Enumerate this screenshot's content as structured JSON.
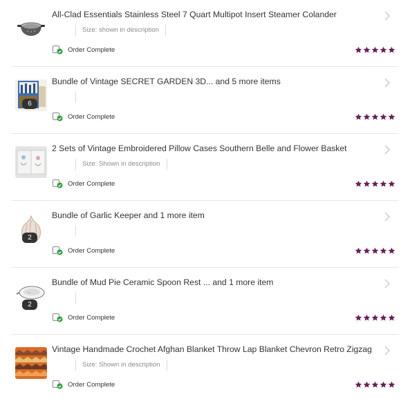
{
  "colors": {
    "star": "#6b1f55",
    "status_check": "#2e9e3e",
    "chevron": "#c8c8c8"
  },
  "orders": [
    {
      "title": "All-Clad Essentials Stainless Steel 7 Quart Multipot Insert Steamer Colander",
      "size": "Size: shown in description",
      "status": "Order Complete",
      "rating": 5,
      "count_badge": "",
      "thumb_icon": "steamer-colander-photo"
    },
    {
      "title": "Bundle of Vintage SECRET GARDEN 3D... and 5 more items",
      "size": "",
      "status": "Order Complete",
      "rating": 5,
      "count_badge": "6",
      "thumb_icon": "secret-garden-book-photo"
    },
    {
      "title": "2 Sets of Vintage Embroidered Pillow Cases Southern Belle and Flower Basket",
      "size": "Size: Shown in description",
      "status": "Order Complete",
      "rating": 5,
      "count_badge": "",
      "thumb_icon": "pillow-cases-photo"
    },
    {
      "title": "Bundle of Garlic Keeper and 1 more item",
      "size": "",
      "status": "Order Complete",
      "rating": 5,
      "count_badge": "2",
      "thumb_icon": "garlic-keeper-photo"
    },
    {
      "title": "Bundle of Mud Pie Ceramic Spoon Rest ... and 1 more item",
      "size": "",
      "status": "Order Complete",
      "rating": 5,
      "count_badge": "2",
      "thumb_icon": "spoon-rest-photo"
    },
    {
      "title": "Vintage Handmade Crochet Afghan Blanket Throw Lap Blanket Chevron Retro Zigzag",
      "size": "Size: Shown in description",
      "status": "Order Complete",
      "rating": 5,
      "count_badge": "",
      "thumb_icon": "crochet-blanket-photo"
    }
  ]
}
